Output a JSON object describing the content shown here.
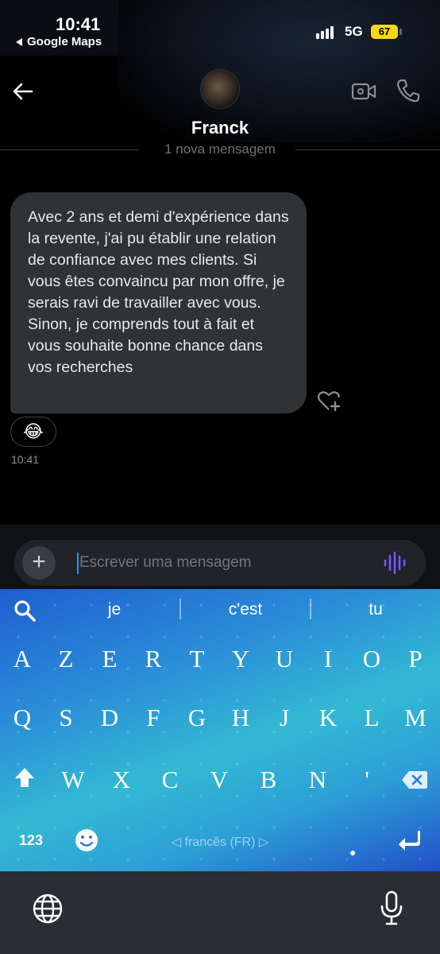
{
  "status_bar": {
    "time": "10:41",
    "back_app": "Google Maps",
    "network": "5G",
    "battery": "67",
    "battery_color": "#f7d61a"
  },
  "header": {
    "contact_name": "Franck",
    "new_messages_divider": "1 nova mensagem"
  },
  "messages": [
    {
      "text": "Avec 2 ans et demi d'expérience dans la revente, j'ai pu établir une relation de confiance avec mes clients. Si vous êtes convaincu par mon offre, je serais ravi de travailler avec vous. Sinon, je comprends tout à fait et vous souhaite bonne chance dans vos recherches",
      "reaction": "😂",
      "time": "10:41"
    }
  ],
  "composer": {
    "placeholder": "Escrever uma mensagem",
    "value": "",
    "accent_color": "#1d9bf0",
    "voice_color": "#7856ff"
  },
  "keyboard": {
    "suggestions": [
      "je",
      "c'est",
      "tu"
    ],
    "row1": [
      "A",
      "Z",
      "E",
      "R",
      "T",
      "Y",
      "U",
      "I",
      "O",
      "P"
    ],
    "row2": [
      "Q",
      "S",
      "D",
      "F",
      "G",
      "H",
      "J",
      "K",
      "L",
      "M"
    ],
    "row3": [
      "W",
      "X",
      "C",
      "V",
      "B",
      "N",
      "'"
    ],
    "numbers_key": "123",
    "language": "francês (FR)"
  }
}
